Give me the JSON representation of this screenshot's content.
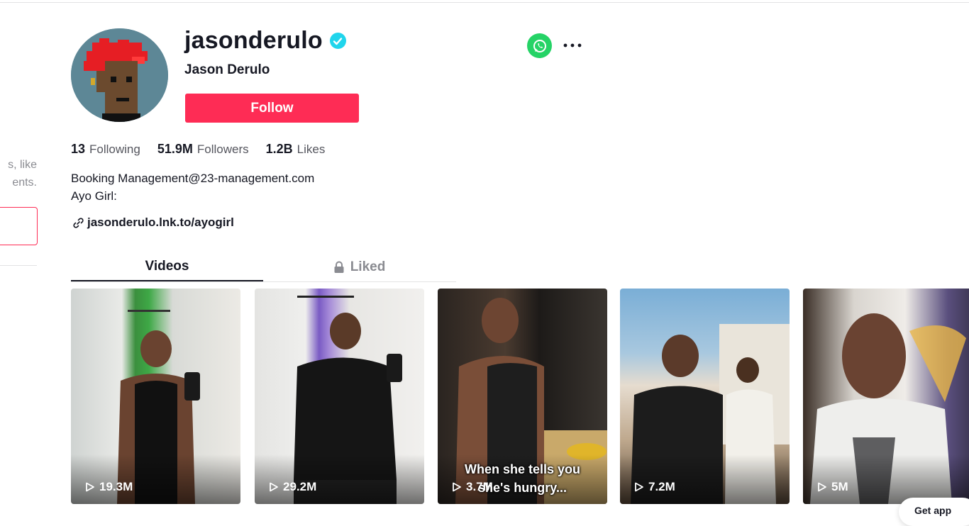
{
  "sidebar": {
    "suggestion_lines": [
      "s, like",
      "ents."
    ]
  },
  "profile": {
    "username": "jasonderulo",
    "display_name": "Jason Derulo",
    "follow_label": "Follow",
    "verified": true,
    "stats": {
      "following_count": "13",
      "following_label": "Following",
      "followers_count": "51.9M",
      "followers_label": "Followers",
      "likes_count": "1.2B",
      "likes_label": "Likes"
    },
    "bio_line1": "Booking Management@23-management.com",
    "bio_line2": "Ayo Girl:",
    "link": "jasonderulo.lnk.to/ayogirl"
  },
  "tabs": {
    "videos_label": "Videos",
    "liked_label": "Liked"
  },
  "videos": [
    {
      "views": "19.3M",
      "caption": ""
    },
    {
      "views": "29.2M",
      "caption": ""
    },
    {
      "views": "3.7M",
      "caption_line1": "When she tells you",
      "caption_line2": "she's hungry..."
    },
    {
      "views": "7.2M",
      "caption": ""
    },
    {
      "views": "5M",
      "caption": ""
    }
  ],
  "get_app_label": "Get app",
  "colors": {
    "accent": "#fe2c55",
    "verified": "#20d5ec",
    "whatsapp": "#25d366",
    "text_primary": "#161823",
    "text_secondary": "#55565e"
  },
  "icons": [
    "verified-badge-icon",
    "whatsapp-icon",
    "more-icon",
    "link-icon",
    "lock-icon",
    "play-icon"
  ]
}
